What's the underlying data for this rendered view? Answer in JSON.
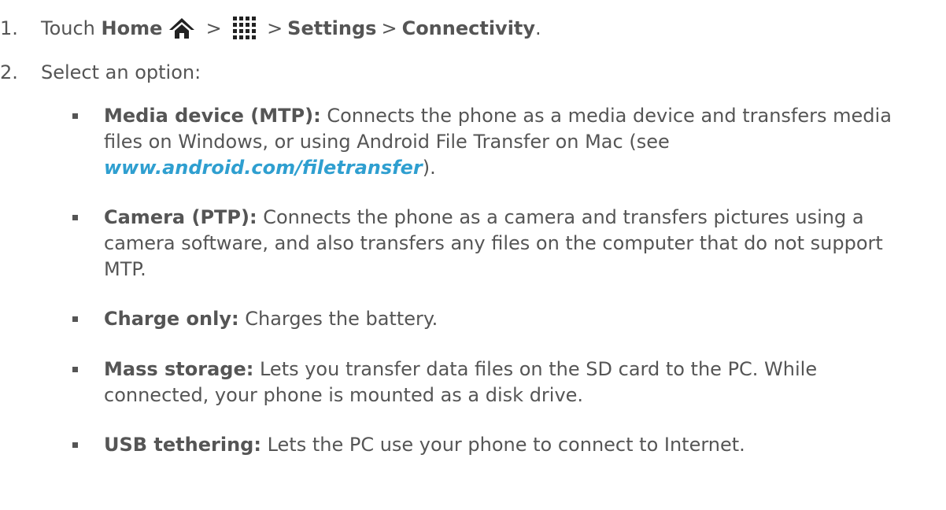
{
  "step1": {
    "number": "1.",
    "touch": "Touch",
    "home": "Home",
    "gt1": ">",
    "gt2": ">",
    "settings": "Settings",
    "gt3": ">",
    "connectivity": "Connectivity",
    "period": ".",
    "icons": [
      "home-icon",
      "apps-grid-icon"
    ]
  },
  "step2": {
    "number": "2.",
    "text": "Select an option:"
  },
  "options": [
    {
      "label": "Media device (MTP):",
      "text_line1": " Connects the phone as a media device and transfers media",
      "text_line2": "files on Windows, or using Android File Transfer on Mac (see",
      "link": "www.android.com/filetransfer",
      "text_end": ")."
    },
    {
      "label": "Camera (PTP):",
      "text_line1": " Connects the phone as a camera and transfers pictures using a",
      "text_line2": "camera software, and also transfers any files on the computer that do not support",
      "text_line3": "MTP."
    },
    {
      "label": "Charge only:",
      "text_line1": " Charges the battery."
    },
    {
      "label": "Mass storage:",
      "text_line1": " Lets you transfer data files on the SD card to the PC. While",
      "text_line2": "connected, your phone is mounted as a disk drive."
    },
    {
      "label": "USB tethering:",
      "text_line1": " Lets the PC use your phone to connect to Internet."
    }
  ],
  "colors": {
    "text": "#555555",
    "link": "#2f9fd0"
  }
}
